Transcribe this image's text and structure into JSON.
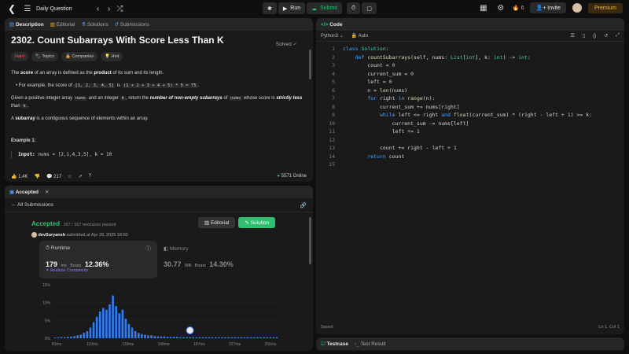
{
  "topbar": {
    "title": "Daily Question",
    "run_label": "Run",
    "submit_label": "Submit",
    "streak": "6",
    "invite_label": "Invite",
    "premium_label": "Premium"
  },
  "description_panel": {
    "tabs": [
      "Description",
      "Editorial",
      "Solutions",
      "Submissions"
    ],
    "title": "2302. Count Subarrays With Score Less Than K",
    "solved": "Solved",
    "chips": [
      "Hard",
      "Topics",
      "Companies",
      "Hint"
    ],
    "p1_a": "The ",
    "p1_b": "score",
    "p1_c": " of an array is defined as the ",
    "p1_d": "product",
    "p1_e": " of its sum and its length.",
    "bullet_a": "For example, the score of ",
    "bullet_code1": "[1, 2, 3, 4, 5]",
    "bullet_b": " is ",
    "bullet_code2": "(1 + 2 + 3 + 4 + 5) * 5 = 75",
    "bullet_c": ".",
    "p2_a": "Given a positive integer array ",
    "p2_code1": "nums",
    "p2_b": " and an integer ",
    "p2_code2": "k",
    "p2_c": ", return the ",
    "p2_d": "number of non-empty subarrays",
    "p2_e": " of ",
    "p2_code3": "nums",
    "p2_f": " whose score is ",
    "p2_g": "strictly less",
    "p2_h": " than ",
    "p2_code4": "k",
    "p2_i": ".",
    "p3_a": "A ",
    "p3_b": "subarray",
    "p3_c": " is a contiguous sequence of elements within an array.",
    "example_title": "Example 1:",
    "example_input_label": "Input:",
    "example_input": "nums = [2,1,4,3,5], k = 10",
    "likes": "1.4K",
    "comments": "217",
    "online": "5571 Online"
  },
  "accepted_panel": {
    "tab": "Accepted",
    "all_submissions": "All Submissions",
    "status": "Accepted",
    "passed": "167 / 167 testcases passed",
    "author": "devSuryansh",
    "submitted": "submitted at Apr 28, 2025 18:50",
    "editorial_label": "Editorial",
    "solution_label": "Solution",
    "runtime_label": "Runtime",
    "runtime_value": "179",
    "runtime_unit": "ms",
    "runtime_beats_label": "Beats",
    "runtime_beats": "12.36%",
    "analyze": "Analyze Complexity",
    "memory_label": "Memory",
    "memory_value": "30.77",
    "memory_unit": "MB",
    "memory_beats_label": "Beats",
    "memory_beats": "14.30%"
  },
  "chart_data": {
    "type": "bar",
    "yticks": [
      "15%",
      "10%",
      "5%",
      "0%"
    ],
    "ylim": [
      0,
      15
    ],
    "xticks": [
      "81ms",
      "110ms",
      "139ms",
      "168ms",
      "197ms",
      "227ms",
      "256ms"
    ],
    "values": [
      0.2,
      0.2,
      0.3,
      0.3,
      0.4,
      0.5,
      0.6,
      0.8,
      1.0,
      1.5,
      2.0,
      3.0,
      4.5,
      6.0,
      7.5,
      8.5,
      8.0,
      9.5,
      12.0,
      9.0,
      7.0,
      8.0,
      5.5,
      4.0,
      3.0,
      2.0,
      1.5,
      1.2,
      1.0,
      0.8,
      0.8,
      0.6,
      0.5,
      0.5,
      0.5,
      0.4,
      0.4,
      0.4,
      0.4,
      0.3,
      0.3,
      0.3,
      0.3,
      0.3,
      0.3,
      0.3,
      0.3,
      0.3,
      0.3,
      0.3,
      0.3,
      0.3,
      0.3,
      0.3,
      0.3,
      0.3,
      0.3,
      0.3,
      0.3,
      0.3,
      0.3,
      0.3,
      0.3,
      0.3,
      0.3,
      0.3,
      0.3,
      0.3,
      0.3,
      0.3
    ],
    "highlight_index": 42,
    "color": "#2f7cf6",
    "grid": true
  },
  "code_panel": {
    "title": "Code",
    "language": "Python3",
    "mode": "Auto",
    "status_left": "Saved",
    "status_right": "Ln 1, Col 1"
  },
  "testcase_panel": {
    "tab1": "Testcase",
    "tab2": "Test Result"
  },
  "colors": {
    "accent_green": "#2fbf71",
    "bar_blue": "#2f7cf6",
    "premium_orange": "#ffb020"
  }
}
